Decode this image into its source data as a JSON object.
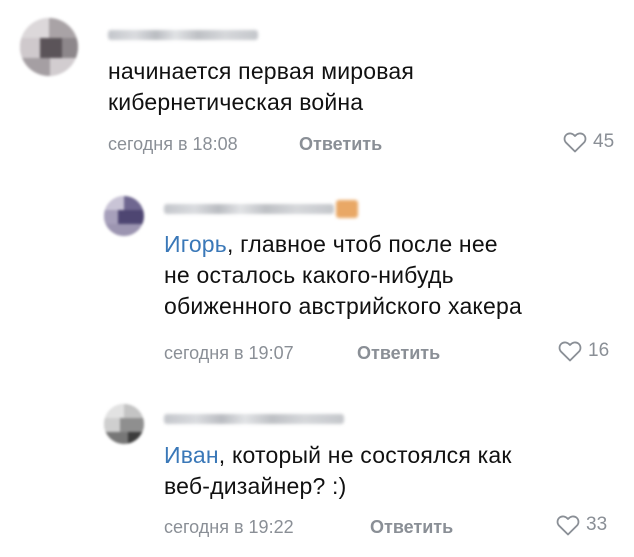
{
  "comments": [
    {
      "author_hidden": true,
      "text_lines": [
        "начинается первая мировая",
        "кибернетическая война"
      ],
      "time": "сегодня в 18:08",
      "reply_label": "Ответить",
      "likes": "45",
      "like_icon": "heart-outline-icon"
    },
    {
      "author_hidden": true,
      "mention": "Игорь",
      "text_first_rest": ", главное чтоб после нее",
      "text_lines": [
        "не осталось какого-нибудь",
        "обиженного австрийского хакера"
      ],
      "time": "сегодня в 19:07",
      "reply_label": "Ответить",
      "likes": "16",
      "like_icon": "heart-outline-icon"
    },
    {
      "author_hidden": true,
      "mention": "Иван",
      "text_first_rest": ", который не состоялся как",
      "text_lines": [
        "веб-дизайнер? :)"
      ],
      "time": "сегодня в 19:22",
      "reply_label": "Ответить",
      "likes": "33",
      "like_icon": "heart-outline-icon"
    }
  ],
  "colors": {
    "mention": "#3a78b8",
    "meta": "#8a8f96",
    "text": "#111111"
  }
}
